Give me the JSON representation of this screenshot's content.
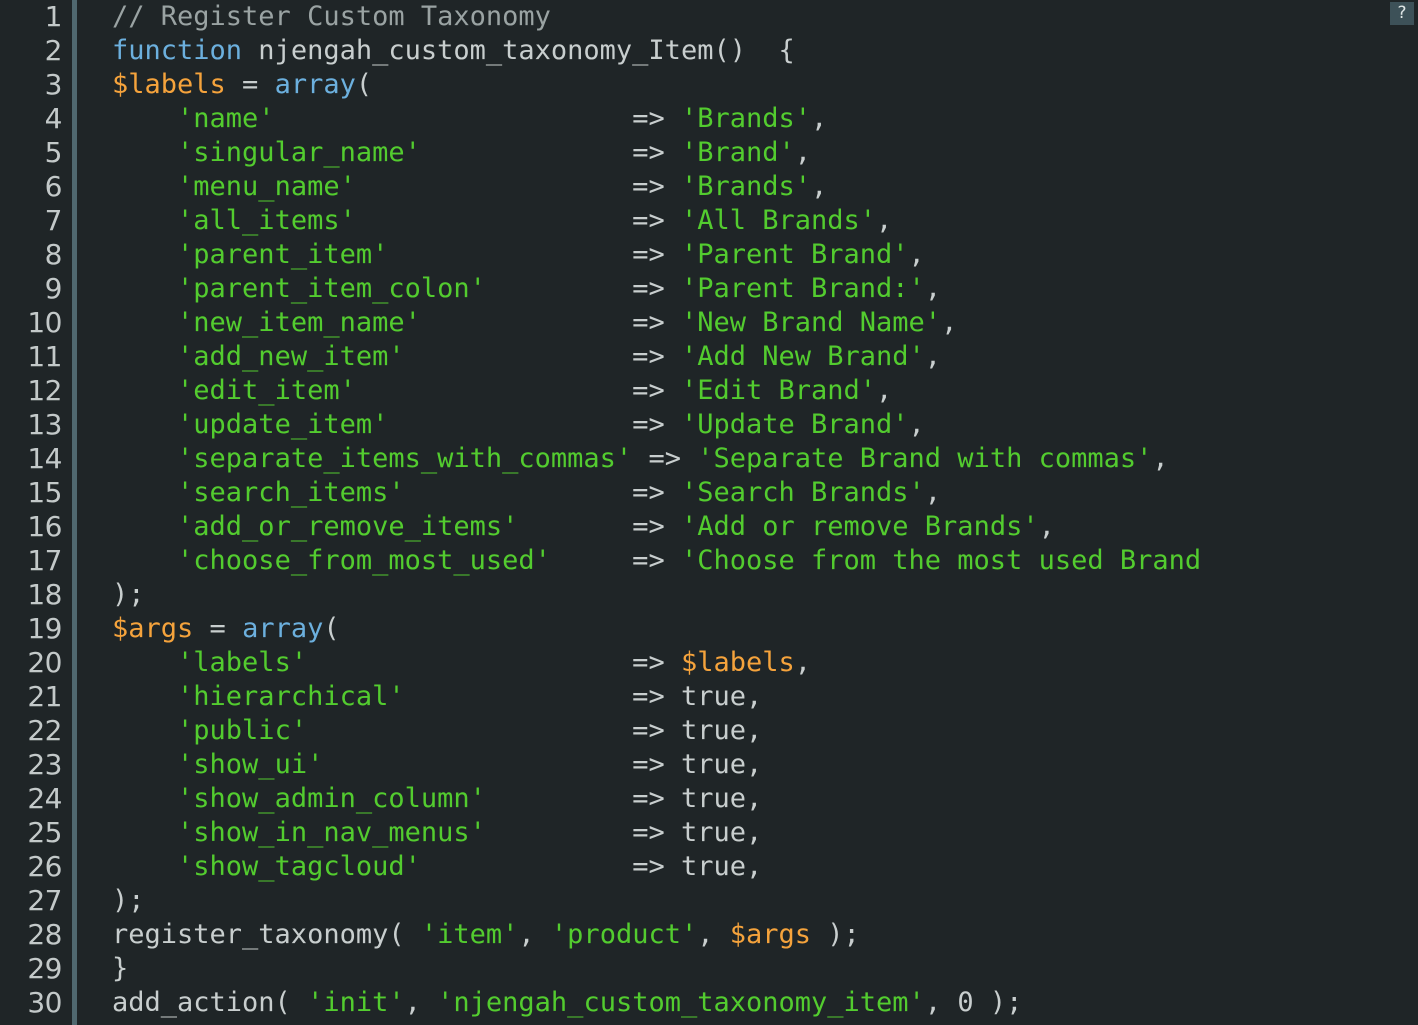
{
  "editor": {
    "language": "PHP",
    "background_color": "#1f2527",
    "gutter_rule_color": "#50686f",
    "default_text_color": "#c8cece",
    "line_count": 30,
    "first_visible_line": 1,
    "last_visible_line": 30
  },
  "colors": {
    "comment": "#9aa3a3",
    "keyword": "#6cb0de",
    "string": "#53cc2f",
    "variable": "#f5a33c",
    "plain": "#c8cece"
  },
  "help_button": {
    "label": "?",
    "icon": "question-mark-icon",
    "background_color": "#3d5158"
  },
  "gutter": {
    "numbers": [
      "1",
      "2",
      "3",
      "4",
      "5",
      "6",
      "7",
      "8",
      "9",
      "10",
      "11",
      "12",
      "13",
      "14",
      "15",
      "16",
      "17",
      "18",
      "19",
      "20",
      "21",
      "22",
      "23",
      "24",
      "25",
      "26",
      "27",
      "28",
      "29",
      "30"
    ]
  },
  "lines": [
    {
      "number": 1,
      "text": "// Register Custom Taxonomy",
      "tokens": [
        {
          "t": "// Register Custom Taxonomy",
          "c": "comment"
        }
      ]
    },
    {
      "number": 2,
      "text": "function njengah_custom_taxonomy_Item()  {",
      "tokens": [
        {
          "t": "function",
          "c": "keyword"
        },
        {
          "t": " njengah_custom_taxonomy_Item()  {",
          "c": "plain"
        }
      ]
    },
    {
      "number": 3,
      "text": "$labels = array(",
      "tokens": [
        {
          "t": "$labels",
          "c": "variable"
        },
        {
          "t": " = ",
          "c": "plain"
        },
        {
          "t": "array",
          "c": "keyword"
        },
        {
          "t": "(",
          "c": "plain"
        }
      ]
    },
    {
      "number": 4,
      "text": "    'name'                      => 'Brands',",
      "tokens": [
        {
          "t": "    ",
          "c": "plain"
        },
        {
          "t": "'name'",
          "c": "string"
        },
        {
          "t": "                      => ",
          "c": "plain"
        },
        {
          "t": "'Brands'",
          "c": "string"
        },
        {
          "t": ",",
          "c": "plain"
        }
      ]
    },
    {
      "number": 5,
      "text": "    'singular_name'             => 'Brand',",
      "tokens": [
        {
          "t": "    ",
          "c": "plain"
        },
        {
          "t": "'singular_name'",
          "c": "string"
        },
        {
          "t": "             => ",
          "c": "plain"
        },
        {
          "t": "'Brand'",
          "c": "string"
        },
        {
          "t": ",",
          "c": "plain"
        }
      ]
    },
    {
      "number": 6,
      "text": "    'menu_name'                 => 'Brands',",
      "tokens": [
        {
          "t": "    ",
          "c": "plain"
        },
        {
          "t": "'menu_name'",
          "c": "string"
        },
        {
          "t": "                 => ",
          "c": "plain"
        },
        {
          "t": "'Brands'",
          "c": "string"
        },
        {
          "t": ",",
          "c": "plain"
        }
      ]
    },
    {
      "number": 7,
      "text": "    'all_items'                 => 'All Brands',",
      "tokens": [
        {
          "t": "    ",
          "c": "plain"
        },
        {
          "t": "'all_items'",
          "c": "string"
        },
        {
          "t": "                 => ",
          "c": "plain"
        },
        {
          "t": "'All Brands'",
          "c": "string"
        },
        {
          "t": ",",
          "c": "plain"
        }
      ]
    },
    {
      "number": 8,
      "text": "    'parent_item'               => 'Parent Brand',",
      "tokens": [
        {
          "t": "    ",
          "c": "plain"
        },
        {
          "t": "'parent_item'",
          "c": "string"
        },
        {
          "t": "               => ",
          "c": "plain"
        },
        {
          "t": "'Parent Brand'",
          "c": "string"
        },
        {
          "t": ",",
          "c": "plain"
        }
      ]
    },
    {
      "number": 9,
      "text": "    'parent_item_colon'         => 'Parent Brand:',",
      "tokens": [
        {
          "t": "    ",
          "c": "plain"
        },
        {
          "t": "'parent_item_colon'",
          "c": "string"
        },
        {
          "t": "         => ",
          "c": "plain"
        },
        {
          "t": "'Parent Brand:'",
          "c": "string"
        },
        {
          "t": ",",
          "c": "plain"
        }
      ]
    },
    {
      "number": 10,
      "text": "    'new_item_name'             => 'New Brand Name',",
      "tokens": [
        {
          "t": "    ",
          "c": "plain"
        },
        {
          "t": "'new_item_name'",
          "c": "string"
        },
        {
          "t": "             => ",
          "c": "plain"
        },
        {
          "t": "'New Brand Name'",
          "c": "string"
        },
        {
          "t": ",",
          "c": "plain"
        }
      ]
    },
    {
      "number": 11,
      "text": "    'add_new_item'              => 'Add New Brand',",
      "tokens": [
        {
          "t": "    ",
          "c": "plain"
        },
        {
          "t": "'add_new_item'",
          "c": "string"
        },
        {
          "t": "              => ",
          "c": "plain"
        },
        {
          "t": "'Add New Brand'",
          "c": "string"
        },
        {
          "t": ",",
          "c": "plain"
        }
      ]
    },
    {
      "number": 12,
      "text": "    'edit_item'                 => 'Edit Brand',",
      "tokens": [
        {
          "t": "    ",
          "c": "plain"
        },
        {
          "t": "'edit_item'",
          "c": "string"
        },
        {
          "t": "                 => ",
          "c": "plain"
        },
        {
          "t": "'Edit Brand'",
          "c": "string"
        },
        {
          "t": ",",
          "c": "plain"
        }
      ]
    },
    {
      "number": 13,
      "text": "    'update_item'               => 'Update Brand',",
      "tokens": [
        {
          "t": "    ",
          "c": "plain"
        },
        {
          "t": "'update_item'",
          "c": "string"
        },
        {
          "t": "               => ",
          "c": "plain"
        },
        {
          "t": "'Update Brand'",
          "c": "string"
        },
        {
          "t": ",",
          "c": "plain"
        }
      ]
    },
    {
      "number": 14,
      "text": "    'separate_items_with_commas' => 'Separate Brand with commas',",
      "tokens": [
        {
          "t": "    ",
          "c": "plain"
        },
        {
          "t": "'separate_items_with_commas'",
          "c": "string"
        },
        {
          "t": " => ",
          "c": "plain"
        },
        {
          "t": "'Separate Brand with commas'",
          "c": "string"
        },
        {
          "t": ",",
          "c": "plain"
        }
      ]
    },
    {
      "number": 15,
      "text": "    'search_items'              => 'Search Brands',",
      "tokens": [
        {
          "t": "    ",
          "c": "plain"
        },
        {
          "t": "'search_items'",
          "c": "string"
        },
        {
          "t": "              => ",
          "c": "plain"
        },
        {
          "t": "'Search Brands'",
          "c": "string"
        },
        {
          "t": ",",
          "c": "plain"
        }
      ]
    },
    {
      "number": 16,
      "text": "    'add_or_remove_items'       => 'Add or remove Brands',",
      "tokens": [
        {
          "t": "    ",
          "c": "plain"
        },
        {
          "t": "'add_or_remove_items'",
          "c": "string"
        },
        {
          "t": "       => ",
          "c": "plain"
        },
        {
          "t": "'Add or remove Brands'",
          "c": "string"
        },
        {
          "t": ",",
          "c": "plain"
        }
      ]
    },
    {
      "number": 17,
      "text": "    'choose_from_most_used'     => 'Choose from the most used Brand",
      "truncated": true,
      "tokens": [
        {
          "t": "    ",
          "c": "plain"
        },
        {
          "t": "'choose_from_most_used'",
          "c": "string"
        },
        {
          "t": "     => ",
          "c": "plain"
        },
        {
          "t": "'Choose from the most used Brand",
          "c": "string"
        }
      ]
    },
    {
      "number": 18,
      "text": ");",
      "tokens": [
        {
          "t": ");",
          "c": "plain"
        }
      ]
    },
    {
      "number": 19,
      "text": "$args = array(",
      "tokens": [
        {
          "t": "$args",
          "c": "variable"
        },
        {
          "t": " = ",
          "c": "plain"
        },
        {
          "t": "array",
          "c": "keyword"
        },
        {
          "t": "(",
          "c": "plain"
        }
      ]
    },
    {
      "number": 20,
      "text": "    'labels'                    => $labels,",
      "tokens": [
        {
          "t": "    ",
          "c": "plain"
        },
        {
          "t": "'labels'",
          "c": "string"
        },
        {
          "t": "                    => ",
          "c": "plain"
        },
        {
          "t": "$labels",
          "c": "variable"
        },
        {
          "t": ",",
          "c": "plain"
        }
      ]
    },
    {
      "number": 21,
      "text": "    'hierarchical'              => true,",
      "tokens": [
        {
          "t": "    ",
          "c": "plain"
        },
        {
          "t": "'hierarchical'",
          "c": "string"
        },
        {
          "t": "              => ",
          "c": "plain"
        },
        {
          "t": "true",
          "c": "bool"
        },
        {
          "t": ",",
          "c": "plain"
        }
      ]
    },
    {
      "number": 22,
      "text": "    'public'                    => true,",
      "tokens": [
        {
          "t": "    ",
          "c": "plain"
        },
        {
          "t": "'public'",
          "c": "string"
        },
        {
          "t": "                    => ",
          "c": "plain"
        },
        {
          "t": "true",
          "c": "bool"
        },
        {
          "t": ",",
          "c": "plain"
        }
      ]
    },
    {
      "number": 23,
      "text": "    'show_ui'                   => true,",
      "tokens": [
        {
          "t": "    ",
          "c": "plain"
        },
        {
          "t": "'show_ui'",
          "c": "string"
        },
        {
          "t": "                   => ",
          "c": "plain"
        },
        {
          "t": "true",
          "c": "bool"
        },
        {
          "t": ",",
          "c": "plain"
        }
      ]
    },
    {
      "number": 24,
      "text": "    'show_admin_column'         => true,",
      "tokens": [
        {
          "t": "    ",
          "c": "plain"
        },
        {
          "t": "'show_admin_column'",
          "c": "string"
        },
        {
          "t": "         => ",
          "c": "plain"
        },
        {
          "t": "true",
          "c": "bool"
        },
        {
          "t": ",",
          "c": "plain"
        }
      ]
    },
    {
      "number": 25,
      "text": "    'show_in_nav_menus'         => true,",
      "tokens": [
        {
          "t": "    ",
          "c": "plain"
        },
        {
          "t": "'show_in_nav_menus'",
          "c": "string"
        },
        {
          "t": "         => ",
          "c": "plain"
        },
        {
          "t": "true",
          "c": "bool"
        },
        {
          "t": ",",
          "c": "plain"
        }
      ]
    },
    {
      "number": 26,
      "text": "    'show_tagcloud'             => true,",
      "tokens": [
        {
          "t": "    ",
          "c": "plain"
        },
        {
          "t": "'show_tagcloud'",
          "c": "string"
        },
        {
          "t": "             => ",
          "c": "plain"
        },
        {
          "t": "true",
          "c": "bool"
        },
        {
          "t": ",",
          "c": "plain"
        }
      ]
    },
    {
      "number": 27,
      "text": ");",
      "tokens": [
        {
          "t": ");",
          "c": "plain"
        }
      ]
    },
    {
      "number": 28,
      "text": "register_taxonomy( 'item', 'product', $args );",
      "tokens": [
        {
          "t": "register_taxonomy( ",
          "c": "plain"
        },
        {
          "t": "'item'",
          "c": "string"
        },
        {
          "t": ", ",
          "c": "plain"
        },
        {
          "t": "'product'",
          "c": "string"
        },
        {
          "t": ", ",
          "c": "plain"
        },
        {
          "t": "$args",
          "c": "variable"
        },
        {
          "t": " );",
          "c": "plain"
        }
      ]
    },
    {
      "number": 29,
      "text": "}",
      "tokens": [
        {
          "t": "}",
          "c": "plain"
        }
      ]
    },
    {
      "number": 30,
      "text": "add_action( 'init', 'njengah_custom_taxonomy_item', 0 );",
      "tokens": [
        {
          "t": "add_action( ",
          "c": "plain"
        },
        {
          "t": "'init'",
          "c": "string"
        },
        {
          "t": ", ",
          "c": "plain"
        },
        {
          "t": "'njengah_custom_taxonomy_item'",
          "c": "string"
        },
        {
          "t": ", 0 );",
          "c": "plain"
        }
      ]
    }
  ]
}
